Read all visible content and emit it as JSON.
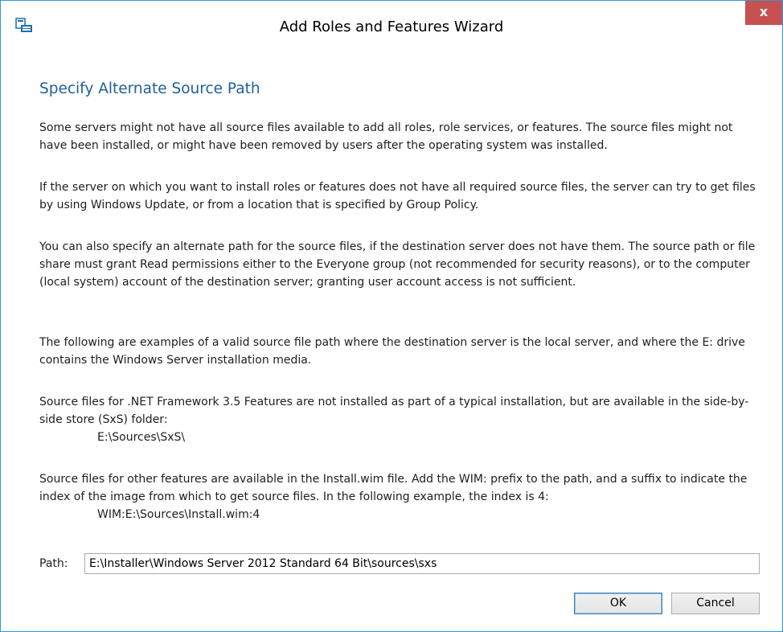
{
  "window": {
    "title": "Add Roles and Features Wizard",
    "close_label": "x"
  },
  "main": {
    "heading": "Specify Alternate Source Path",
    "paragraphs": [
      "Some servers might not have all source files available to add all roles, role services, or features. The source files might not have been installed, or might have been removed by users after the operating system was installed.",
      "If the server on which you want to install roles or features does not have all required source files, the server can try to get files by using Windows Update, or from a location that is specified by Group Policy.",
      "You can also specify an alternate path for the source files, if the destination server does not have them. The source path or file share must grant Read permissions either to the Everyone group (not recommended for security reasons), or to the computer (local system) account of the destination server; granting user account access is not sufficient.",
      "The following are examples of a valid source file path where the destination server is the local server, and where the E: drive contains the Windows Server installation media.",
      "Source files for .NET Framework 3.5 Features are not installed as part of a typical installation, but are available in the side-by-side store (SxS) folder:",
      "Source files for other features are available in the Install.wim file. Add the WIM: prefix to the path, and a suffix to indicate the index of the image from which to get source files. In the following example, the index is 4:"
    ],
    "examples": [
      "E:\\Sources\\SxS\\",
      "WIM:E:\\Sources\\Install.wim:4"
    ]
  },
  "path": {
    "label": "Path:",
    "value": "E:\\Installer\\Windows Server 2012 Standard 64 Bit\\sources\\sxs"
  },
  "buttons": {
    "ok": "OK",
    "cancel": "Cancel"
  },
  "colors": {
    "accent": "#2e9ad6",
    "heading": "#1e5f9c",
    "close": "#c75050"
  }
}
